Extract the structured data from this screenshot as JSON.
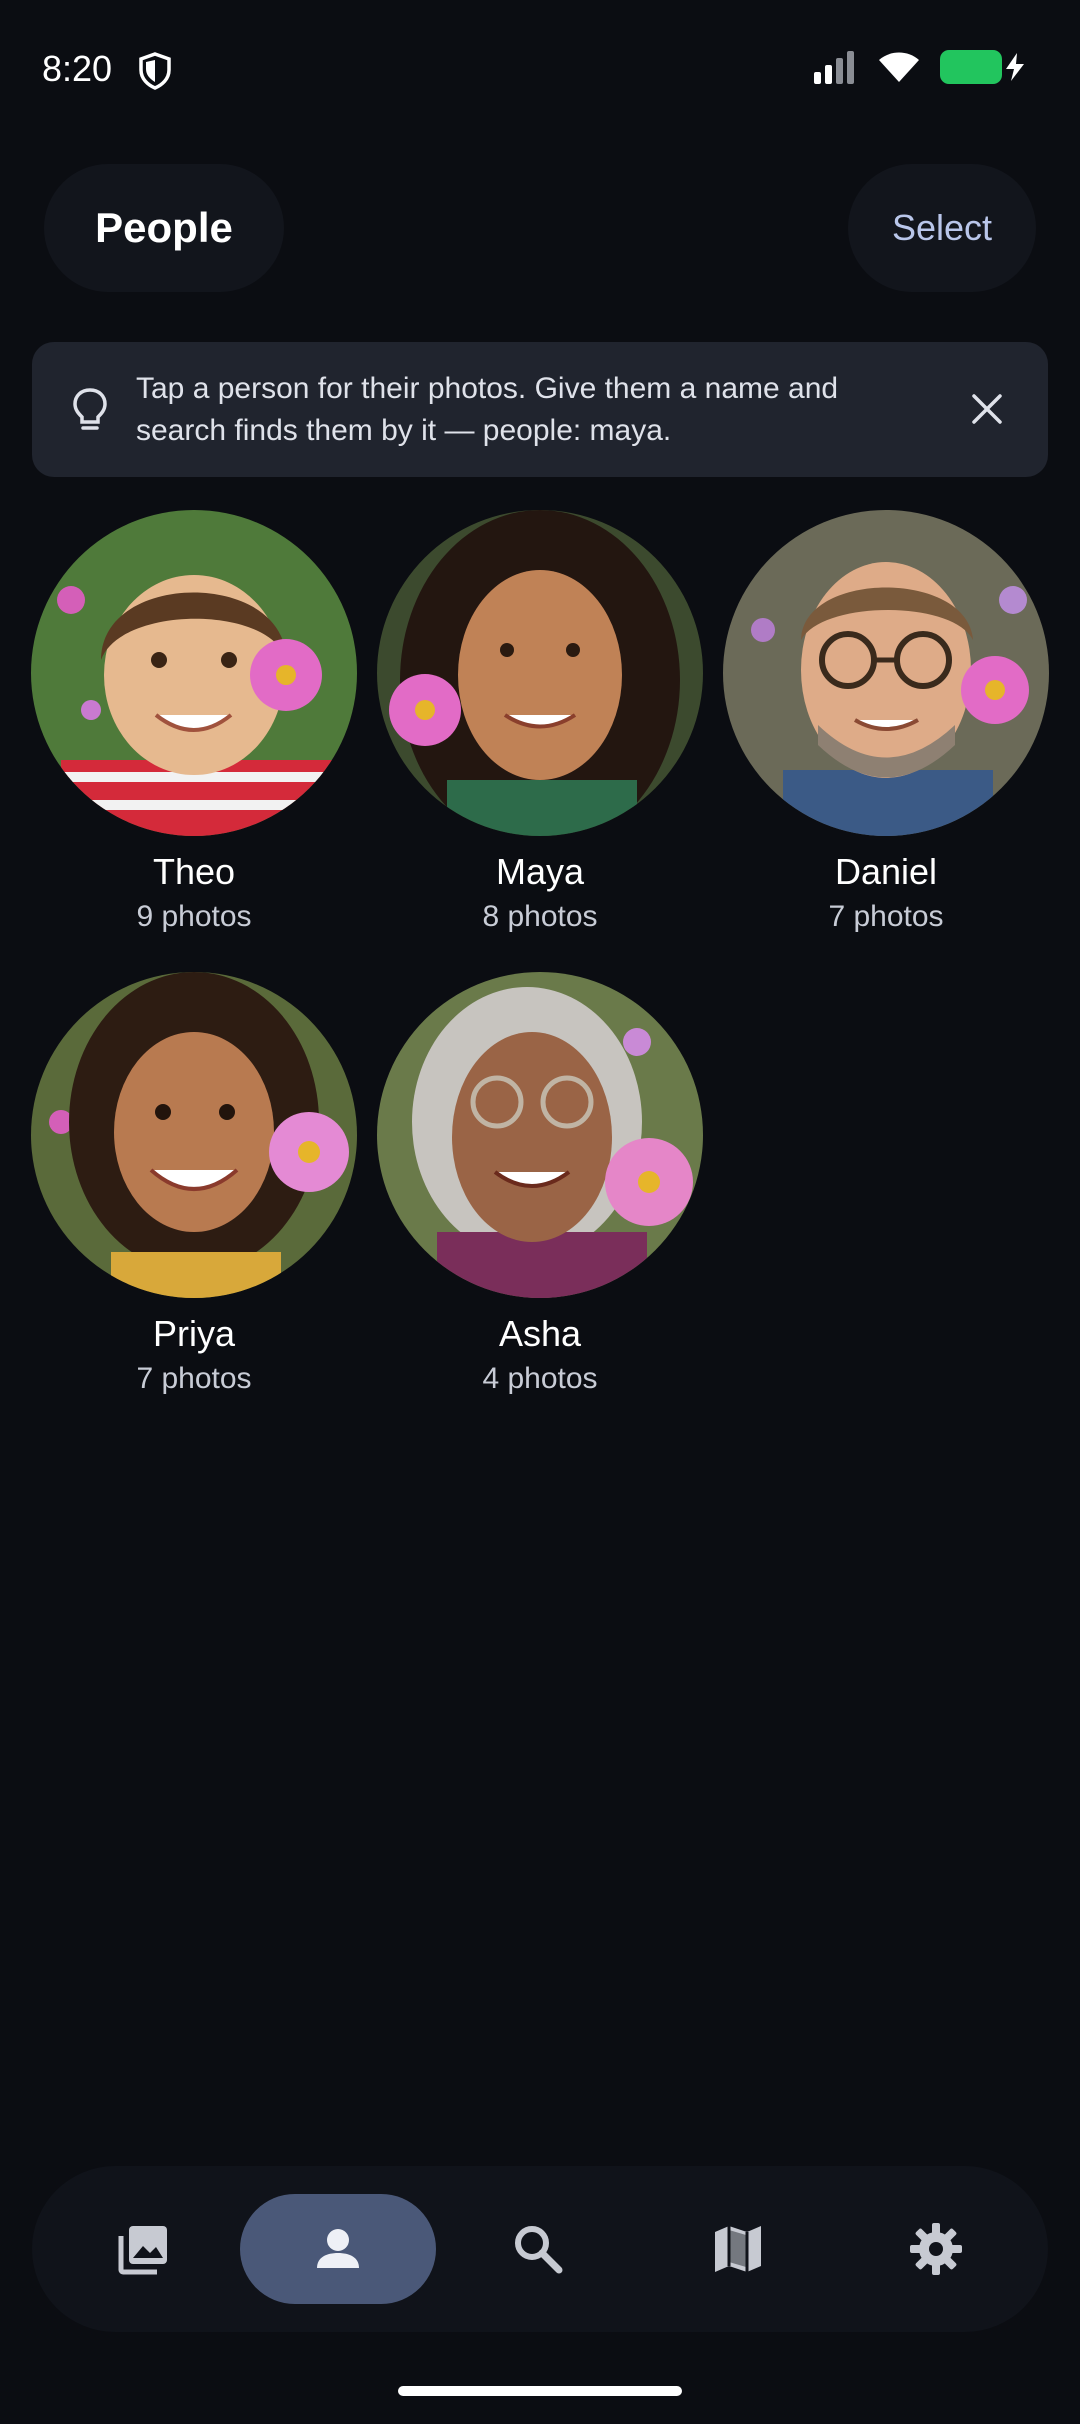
{
  "status_bar": {
    "time": "8:20",
    "battery_color": "#22c55e"
  },
  "header": {
    "title": "People",
    "select_label": "Select"
  },
  "tip": {
    "icon": "lightbulb-icon",
    "text": "Tap a person for their photos. Give them a name and search finds them by it — people: maya.",
    "close_icon": "close-icon"
  },
  "people": [
    {
      "name": "Theo",
      "count": "9 photos"
    },
    {
      "name": "Maya",
      "count": "8 photos"
    },
    {
      "name": "Daniel",
      "count": "7 photos"
    },
    {
      "name": "Priya",
      "count": "7 photos"
    },
    {
      "name": "Asha",
      "count": "4 photos"
    }
  ],
  "nav": {
    "items": [
      {
        "icon": "photos-icon",
        "active": false
      },
      {
        "icon": "person-icon",
        "active": true
      },
      {
        "icon": "search-icon",
        "active": false
      },
      {
        "icon": "map-icon",
        "active": false
      },
      {
        "icon": "gear-icon",
        "active": false
      }
    ],
    "active_color": "#4a5878"
  }
}
